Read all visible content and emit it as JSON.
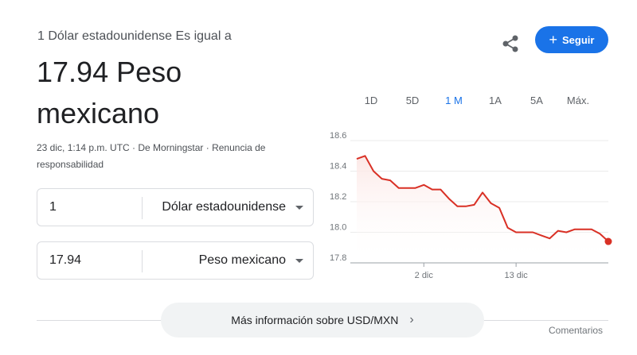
{
  "header": {
    "subtitle": "1 Dólar estadounidense Es igual a",
    "value_line1": "17.94 Peso",
    "value_line2": "mexicano",
    "meta_text": "23 dic, 1:14 p.m. UTC · De Morningstar · ",
    "disclaimer_link": "Renuncia de responsabilidad"
  },
  "actions": {
    "share_icon": "share-icon",
    "follow_label": "Seguir",
    "follow_icon": "plus-icon"
  },
  "converter": {
    "from_amount": "1",
    "from_currency": "Dólar estadounidense",
    "to_amount": "17.94",
    "to_currency": "Peso mexicano"
  },
  "ranges": {
    "items": [
      "1D",
      "5D",
      "1 M",
      "1A",
      "5A",
      "Máx."
    ],
    "active": "1 M"
  },
  "chart_data": {
    "type": "area",
    "y_ticks": [
      "18.6",
      "18.4",
      "18.2",
      "18.0",
      "17.8"
    ],
    "ylim": [
      17.8,
      18.6
    ],
    "x_ticks": [
      "2 dic",
      "13 dic"
    ],
    "colors": {
      "line": "#d93025",
      "fill": "#fce8e6"
    },
    "values": [
      18.48,
      18.5,
      18.4,
      18.35,
      18.34,
      18.29,
      18.29,
      18.29,
      18.31,
      18.28,
      18.28,
      18.22,
      18.17,
      18.17,
      18.18,
      18.26,
      18.19,
      18.16,
      18.03,
      18.0,
      18.0,
      18.0,
      17.98,
      17.96,
      18.01,
      18.0,
      18.02,
      18.02,
      18.02,
      17.99,
      17.94
    ]
  },
  "footer": {
    "more_label": "Más información sobre USD/MXN",
    "feedback_label": "Comentarios"
  }
}
